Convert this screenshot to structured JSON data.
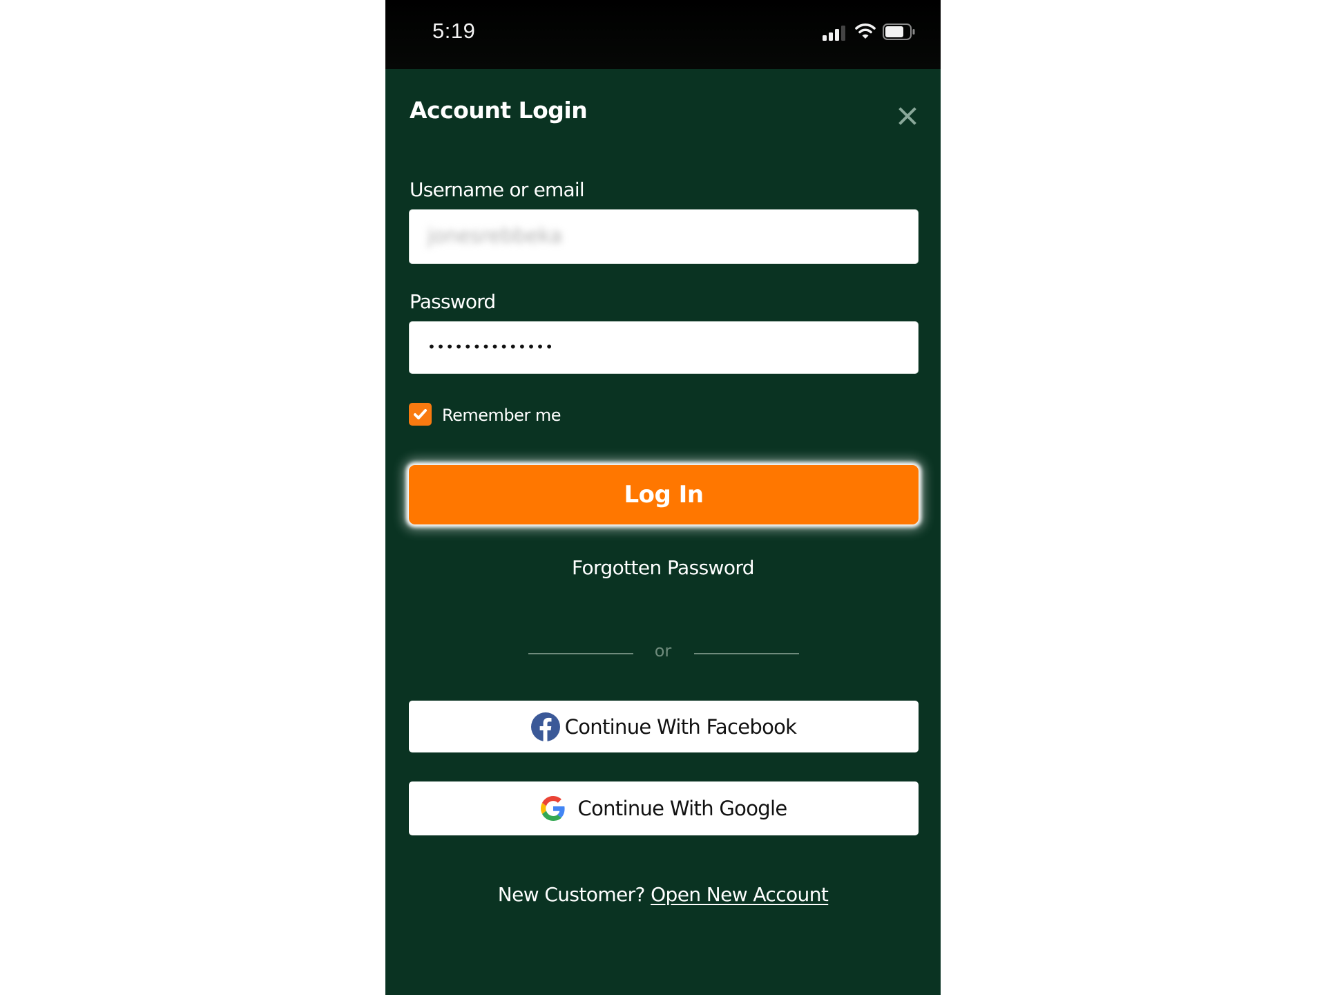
{
  "status_bar": {
    "time": "5:19",
    "icons": [
      "cellular-signal-icon",
      "wifi-icon",
      "battery-icon"
    ]
  },
  "header": {
    "title": "Account Login",
    "close_icon": "close-icon"
  },
  "form": {
    "username": {
      "label": "Username or email",
      "value": "jonesrebbeka"
    },
    "password": {
      "label": "Password",
      "masked_value": "••••••••••••••"
    },
    "remember_me": {
      "label": "Remember me",
      "checked": true
    },
    "login_button": "Log In",
    "forgot_link": "Forgotten Password"
  },
  "divider": {
    "text": "or"
  },
  "social": {
    "facebook": "Continue With Facebook",
    "google": "Continue With Google"
  },
  "footer": {
    "prompt": "New Customer?",
    "link": "Open New Account"
  },
  "colors": {
    "background": "#0a3322",
    "accent": "#ff7700",
    "facebook": "#3b5998"
  }
}
